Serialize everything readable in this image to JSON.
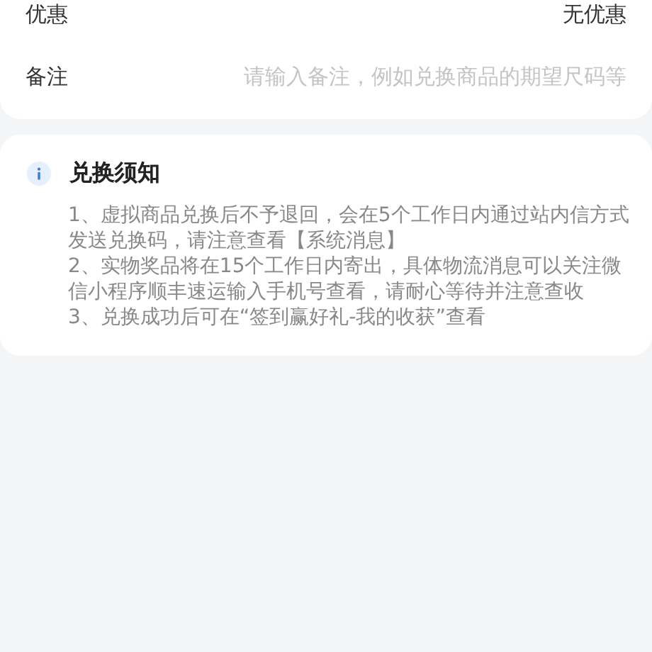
{
  "order_form": {
    "rows": [
      {
        "kind": "value",
        "label": "优惠",
        "value": "无优惠"
      },
      {
        "kind": "input",
        "label": "备注",
        "placeholder": "请输入备注，例如兑换商品的期望尺码等"
      }
    ]
  },
  "notice": {
    "title": "兑换须知",
    "items": [
      "1、虚拟商品兑换后不予退回，会在5个工作日内通过站内信方式发送兑换码，请注意查看【系统消息】",
      "2、实物奖品将在15个工作日内寄出，具体物流消息可以关注微信小程序顺丰速运输入手机号查看，请耐心等待并注意查收",
      "3、兑换成功后可在“签到赢好礼-我的收获”查看"
    ]
  }
}
